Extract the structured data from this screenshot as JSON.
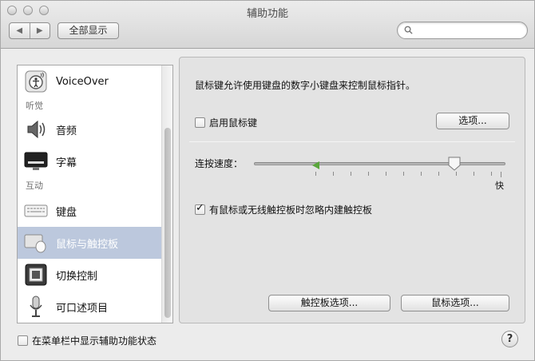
{
  "window": {
    "title": "辅助功能"
  },
  "toolbar": {
    "back": "◀",
    "forward": "▶",
    "show_all": "全部显示",
    "search_placeholder": ""
  },
  "sidebar": {
    "items": [
      {
        "label": "VoiceOver",
        "icon": "voiceover-icon"
      },
      {
        "label": "音频",
        "icon": "speaker-icon"
      },
      {
        "label": "字幕",
        "icon": "captions-icon"
      },
      {
        "label": "键盘",
        "icon": "keyboard-icon"
      },
      {
        "label": "鼠标与触控板",
        "icon": "mouse-trackpad-icon",
        "selected": true
      },
      {
        "label": "切换控制",
        "icon": "switch-control-icon"
      },
      {
        "label": "可口述项目",
        "icon": "microphone-icon"
      }
    ],
    "headers": {
      "hearing": "听觉",
      "interaction": "互动"
    }
  },
  "panel": {
    "description": "鼠标键允许使用键盘的数字小键盘来控制鼠标指针。",
    "enable_mouse_keys": "启用鼠标键",
    "options_button": "选项...",
    "speed_label": "连按速度：",
    "fast_label": "快",
    "double_click_speed": 0.8,
    "ignore_trackpad": "有鼠标或无线触控板时忽略内建触控板",
    "trackpad_options": "触控板选项...",
    "mouse_options": "鼠标选项..."
  },
  "footer": {
    "show_status": "在菜单栏中显示辅助功能状态",
    "help": "?"
  },
  "colors": {
    "selected_row": "#bcc8dd",
    "marker": "#5aa63c"
  }
}
